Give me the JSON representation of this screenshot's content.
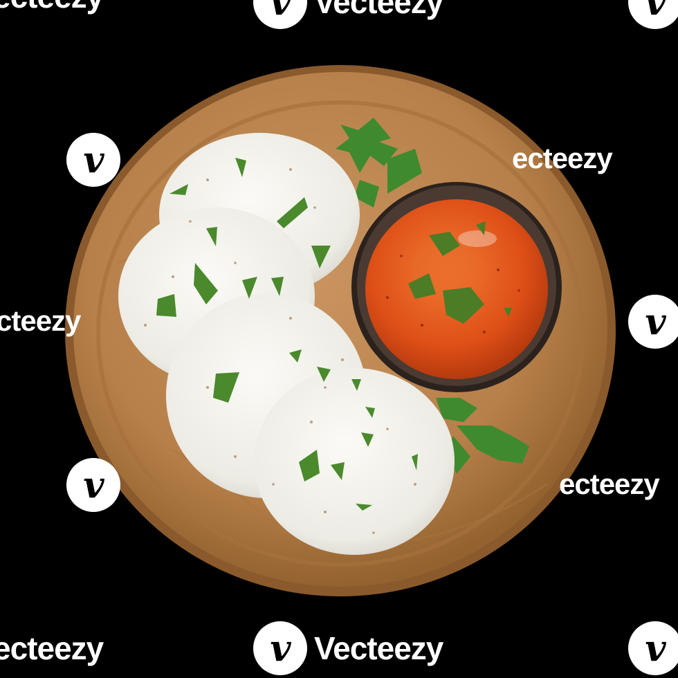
{
  "image": {
    "subject": "idli with chutney on a wooden plate",
    "colors": {
      "background": "#000000",
      "plate": "#b9834d",
      "plate_rim": "#9c6a3a",
      "idli": "#f3f1ec",
      "chutney": "#e2551c",
      "bowl": "#3a2e28",
      "cilantro": "#3f8a2e"
    }
  },
  "watermark": {
    "brand": "Vecteezy",
    "logo_glyph": "v",
    "text_top_left": "ecteezy",
    "text_top_center": "Vecteezy",
    "text_mid_right": "ecteezy",
    "text_mid_left": "cteezy",
    "text_low_right": "ecteezy",
    "text_bottom_left": "ecteezy",
    "text_bottom_center": "Vecteezy"
  }
}
